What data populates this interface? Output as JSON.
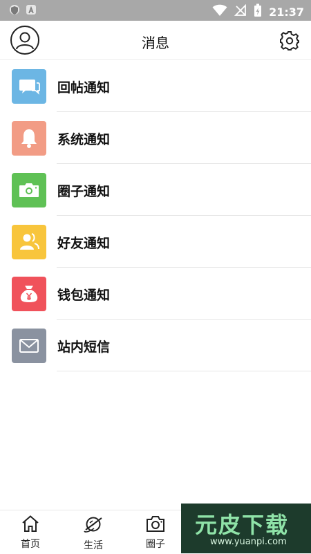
{
  "status_bar": {
    "time": "21:37",
    "left_icons": [
      "shield-icon",
      "a-box-icon"
    ],
    "right_icons": [
      "wifi-icon",
      "no-signal-icon",
      "battery-charging-icon"
    ]
  },
  "header": {
    "title": "消息",
    "left_icon": "user-avatar-icon",
    "right_icon": "gear-icon"
  },
  "list": {
    "items": [
      {
        "label": "回帖通知",
        "icon": "chat-bubble-icon",
        "color": "#6cb6e4"
      },
      {
        "label": "系统通知",
        "icon": "bell-icon",
        "color": "#f29c85"
      },
      {
        "label": "圈子通知",
        "icon": "camera-icon",
        "color": "#5fc155"
      },
      {
        "label": "好友通知",
        "icon": "friends-icon",
        "color": "#f8c53c"
      },
      {
        "label": "钱包通知",
        "icon": "money-bag-icon",
        "color": "#f0525b"
      },
      {
        "label": "站内短信",
        "icon": "envelope-icon",
        "color": "#8a92a0"
      }
    ]
  },
  "tab_bar": {
    "tabs": [
      {
        "label": "首页",
        "icon": "home-icon"
      },
      {
        "label": "生活",
        "icon": "planet-icon"
      },
      {
        "label": "圈子",
        "icon": "camera-icon"
      }
    ]
  },
  "watermark": {
    "text": "元皮下载",
    "url": "www.yuanpi.com"
  }
}
